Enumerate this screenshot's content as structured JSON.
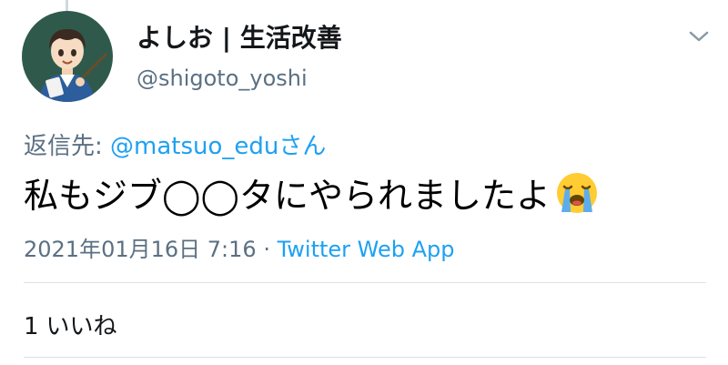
{
  "tweet": {
    "author": {
      "display_name": "よしお | 生活改善",
      "handle": "@shigoto_yoshi"
    },
    "reply_to": {
      "prefix": "返信先: ",
      "mention": "@matsuo_edu",
      "suffix": "さん"
    },
    "text": "私もジブ◯◯タにやられましたよ",
    "emoji": "loudly-crying-face-icon",
    "meta": {
      "timestamp": "2021年01月16日 7:16",
      "separator": " · ",
      "source": "Twitter Web App"
    },
    "likes": {
      "count": "1",
      "label": "いいね"
    }
  },
  "colors": {
    "link": "#1da1f2",
    "secondary_text": "#5b7083",
    "divider": "#dbe1e5"
  }
}
